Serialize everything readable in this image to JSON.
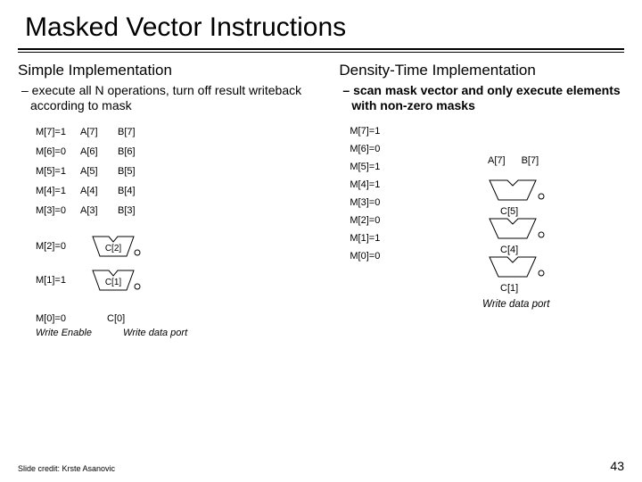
{
  "title": "Masked Vector Instructions",
  "left": {
    "heading": "Simple Implementation",
    "bullet": "– execute all N operations, turn off result writeback according to mask",
    "rows": [
      {
        "m": "M[7]=1",
        "a": "A[7]",
        "b": "B[7]"
      },
      {
        "m": "M[6]=0",
        "a": "A[6]",
        "b": "B[6]"
      },
      {
        "m": "M[5]=1",
        "a": "A[5]",
        "b": "B[5]"
      },
      {
        "m": "M[4]=1",
        "a": "A[4]",
        "b": "B[4]"
      },
      {
        "m": "M[3]=0",
        "a": "A[3]",
        "b": "B[3]"
      }
    ],
    "alu": [
      {
        "m": "M[2]=0",
        "c": "C[2]"
      },
      {
        "m": "M[1]=1",
        "c": "C[1]"
      }
    ],
    "last": {
      "m": "M[0]=0",
      "c": "C[0]"
    },
    "we": "Write Enable",
    "wdp": "Write data port"
  },
  "right": {
    "heading": "Density-Time Implementation",
    "bullet": "– scan mask vector and only execute elements with non-zero masks",
    "masks": [
      "M[7]=1",
      "M[6]=0",
      "M[5]=1",
      "M[4]=1",
      "M[3]=0",
      "M[2]=0",
      "M[1]=1",
      "M[0]=0"
    ],
    "pair": {
      "a": "A[7]",
      "b": "B[7]"
    },
    "c": [
      "C[5]",
      "C[4]",
      "C[1]"
    ],
    "wdp": "Write data port"
  },
  "credit": "Slide credit: Krste Asanovic",
  "page": "43"
}
